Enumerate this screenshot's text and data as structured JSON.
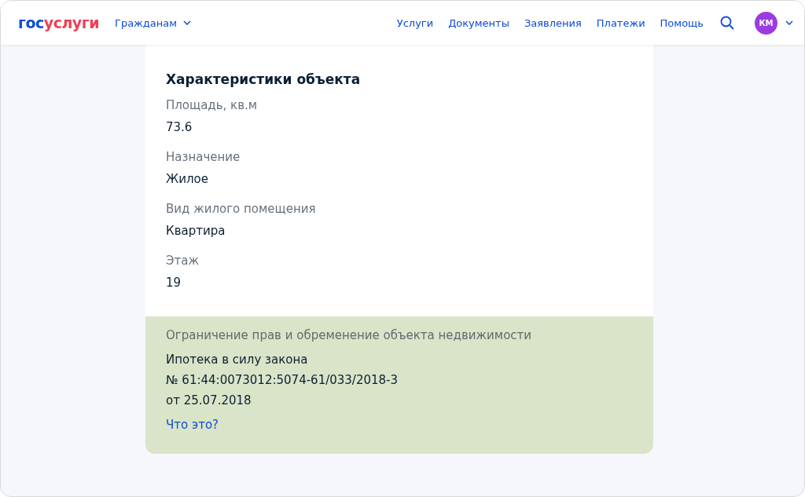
{
  "header": {
    "logo": {
      "first": "гос",
      "second": "услуги"
    },
    "audience_menu": "Гражданам",
    "nav": [
      "Услуги",
      "Документы",
      "Заявления",
      "Платежи",
      "Помощь"
    ],
    "avatar": "КМ"
  },
  "card": {
    "title": "Характеристики объекта",
    "fields": [
      {
        "label": "Площадь, кв.м",
        "value": "73.6"
      },
      {
        "label": "Назначение",
        "value": "Жилое"
      },
      {
        "label": "Вид жилого помещения",
        "value": "Квартира"
      },
      {
        "label": "Этаж",
        "value": "19"
      }
    ],
    "encumbrance": {
      "label": "Ограничение прав и обременение объекта недвижимости",
      "lines": [
        "Ипотека в силу закона",
        "№ 61:44:0073012:5074-61/033/2018-3",
        "от 25.07.2018"
      ],
      "link": "Что это?"
    }
  }
}
